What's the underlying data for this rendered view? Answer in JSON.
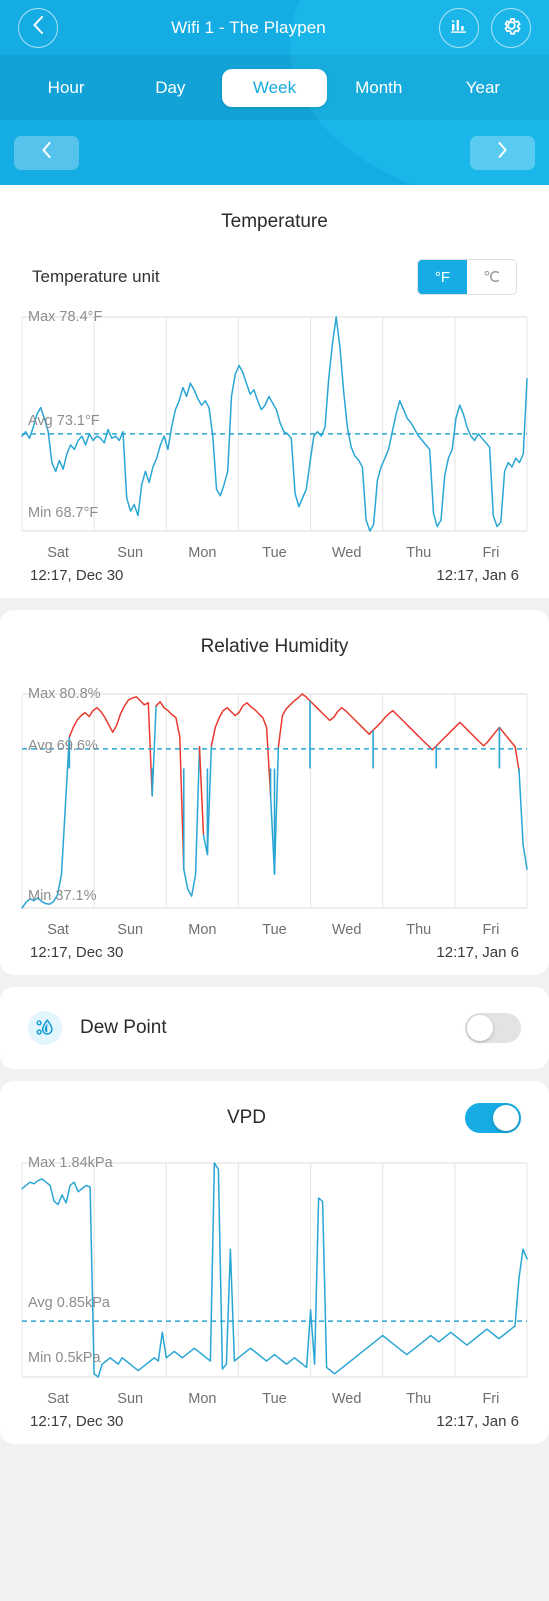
{
  "header": {
    "title": "Wifi 1 - The Playpen",
    "back_icon": "chevron-left-icon",
    "stats_icon": "bar-chart-icon",
    "settings_icon": "gear-icon"
  },
  "tabs": [
    {
      "label": "Hour",
      "active": false
    },
    {
      "label": "Day",
      "active": false
    },
    {
      "label": "Week",
      "active": true
    },
    {
      "label": "Month",
      "active": false
    },
    {
      "label": "Year",
      "active": false
    }
  ],
  "pager": {
    "prev_icon": "chevron-left-icon",
    "next_icon": "chevron-right-icon"
  },
  "temperature": {
    "title": "Temperature",
    "unit_label": "Temperature unit",
    "unit_options": [
      "°F",
      "℃"
    ],
    "unit_selected": "°F",
    "max_label": "Max 78.4°F",
    "avg_label": "Avg 73.1°F",
    "min_label": "Min 68.7°F",
    "range_start": "12:17,  Dec 30",
    "range_end": "12:17,  Jan 6",
    "days": [
      "Sat",
      "Sun",
      "Mon",
      "Tue",
      "Wed",
      "Thu",
      "Fri"
    ]
  },
  "humidity": {
    "title": "Relative Humidity",
    "max_label": "Max 80.8%",
    "avg_label": "Avg 69.6%",
    "min_label": "Min 37.1%",
    "range_start": "12:17,  Dec 30",
    "range_end": "12:17,  Jan 6",
    "days": [
      "Sat",
      "Sun",
      "Mon",
      "Tue",
      "Wed",
      "Thu",
      "Fri"
    ]
  },
  "dew_point": {
    "label": "Dew Point",
    "icon": "humidity-drop-icon",
    "enabled": false
  },
  "vpd": {
    "title": "VPD",
    "enabled": true,
    "max_label": "Max 1.84kPa",
    "avg_label": "Avg 0.85kPa",
    "min_label": "Min 0.5kPa",
    "range_start": "12:17,  Dec 30",
    "range_end": "12:17,  Jan 6",
    "days": [
      "Sat",
      "Sun",
      "Mon",
      "Tue",
      "Wed",
      "Thu",
      "Fri"
    ]
  },
  "colors": {
    "brand": "#17ace4",
    "header": "#14ace3",
    "line_blue": "#2aa6d4",
    "line_red": "#e8392f",
    "grid": "#e8e8e8",
    "avg_dash": "#2aa6d4"
  },
  "chart_data": [
    {
      "type": "line",
      "title": "Temperature",
      "xlabel": "",
      "ylabel": "°F",
      "ylim": [
        68.7,
        78.4
      ],
      "max": 78.4,
      "avg": 73.1,
      "min": 68.7,
      "unit": "°F",
      "categories": [
        "Sat",
        "Sun",
        "Mon",
        "Tue",
        "Wed",
        "Thu",
        "Fri"
      ],
      "x_start": "12:17, Dec 30",
      "x_end": "12:17, Jan 6",
      "grid": true,
      "legend": "none",
      "series": [
        {
          "name": "Temperature",
          "color": "#2aa6d4",
          "values": [
            73.0,
            73.2,
            72.9,
            73.4,
            74.0,
            74.3,
            73.8,
            73.2,
            71.8,
            71.4,
            71.9,
            71.5,
            72.2,
            72.6,
            72.4,
            72.8,
            73.0,
            72.6,
            73.1,
            72.8,
            73.0,
            72.9,
            72.7,
            73.3,
            72.9,
            73.0,
            72.8,
            73.2,
            70.2,
            69.6,
            69.9,
            69.4,
            70.8,
            71.4,
            70.9,
            71.6,
            72.0,
            72.6,
            73.0,
            72.4,
            73.4,
            74.2,
            74.6,
            75.2,
            74.8,
            75.4,
            75.1,
            74.7,
            74.4,
            74.6,
            74.3,
            73.0,
            70.6,
            70.3,
            70.8,
            71.4,
            74.8,
            75.8,
            76.2,
            75.9,
            75.4,
            74.9,
            75.1,
            74.6,
            74.2,
            74.4,
            74.8,
            74.5,
            74.2,
            73.6,
            73.2,
            73.1,
            72.9,
            70.4,
            69.8,
            70.2,
            70.6,
            71.8,
            73.0,
            73.2,
            73.0,
            73.4,
            75.6,
            77.2,
            78.4,
            77.0,
            75.0,
            73.4,
            72.5,
            72.1,
            71.9,
            71.6,
            69.2,
            68.7,
            69.0,
            71.0,
            71.6,
            72.0,
            72.4,
            73.2,
            74.0,
            74.6,
            74.2,
            73.8,
            73.6,
            73.3,
            73.0,
            72.8,
            72.6,
            72.4,
            69.5,
            68.9,
            69.2,
            71.2,
            72.0,
            72.4,
            73.8,
            74.4,
            74.0,
            73.4,
            73.0,
            72.8,
            73.1,
            72.9,
            72.7,
            72.5,
            69.4,
            68.9,
            69.1,
            71.4,
            71.8,
            71.6,
            72.0,
            71.8,
            72.2,
            75.6
          ]
        }
      ]
    },
    {
      "type": "line",
      "title": "Relative Humidity",
      "xlabel": "",
      "ylabel": "%",
      "ylim": [
        37.1,
        80.8
      ],
      "max": 80.8,
      "avg": 69.6,
      "min": 37.1,
      "unit": "%",
      "categories": [
        "Sat",
        "Sun",
        "Mon",
        "Tue",
        "Wed",
        "Thu",
        "Fri"
      ],
      "x_start": "12:17, Dec 30",
      "x_end": "12:17, Jan 6",
      "grid": true,
      "legend": "none",
      "note": "red segments above threshold, blue segments below",
      "series": [
        {
          "name": "Relative Humidity",
          "color": "#e8392f",
          "values": [
            37.1,
            38.2,
            39.0,
            38.6,
            39.2,
            38.4,
            38.0,
            37.9,
            38.4,
            39.8,
            44.0,
            58.0,
            72.0,
            74.0,
            75.5,
            76.4,
            77.0,
            76.2,
            77.4,
            78.0,
            77.2,
            76.0,
            74.5,
            73.0,
            74.4,
            76.8,
            78.4,
            79.6,
            80.0,
            80.2,
            79.4,
            78.6,
            79.0,
            60.0,
            78.4,
            79.2,
            78.0,
            77.4,
            76.6,
            76.0,
            72.0,
            45.0,
            41.0,
            39.5,
            44.0,
            70.0,
            52.0,
            48.0,
            70.2,
            74.0,
            76.0,
            77.4,
            78.0,
            77.2,
            76.4,
            77.0,
            78.4,
            79.0,
            78.2,
            77.6,
            76.8,
            76.0,
            74.0,
            60.0,
            44.0,
            70.0,
            76.4,
            77.8,
            78.6,
            79.4,
            80.0,
            80.8,
            80.2,
            79.4,
            78.6,
            77.8,
            77.0,
            76.2,
            75.4,
            76.0,
            77.2,
            78.0,
            77.4,
            76.6,
            75.8,
            75.0,
            74.2,
            73.4,
            72.6,
            73.4,
            74.2,
            75.0,
            76.0,
            76.8,
            77.4,
            76.6,
            75.8,
            75.0,
            74.2,
            73.4,
            72.6,
            71.8,
            71.0,
            70.2,
            69.4,
            70.2,
            71.0,
            71.8,
            72.6,
            73.4,
            74.2,
            75.0,
            74.2,
            73.4,
            72.6,
            71.8,
            71.0,
            70.2,
            71.0,
            72.0,
            73.0,
            74.0,
            73.0,
            72.0,
            71.0,
            70.0,
            65.0,
            50.0,
            45.0
          ]
        }
      ]
    },
    {
      "type": "line",
      "title": "VPD",
      "xlabel": "",
      "ylabel": "kPa",
      "ylim": [
        0.5,
        1.84
      ],
      "max": 1.84,
      "avg": 0.85,
      "min": 0.5,
      "unit": "kPa",
      "categories": [
        "Sat",
        "Sun",
        "Mon",
        "Tue",
        "Wed",
        "Thu",
        "Fri"
      ],
      "x_start": "12:17, Dec 30",
      "x_end": "12:17, Jan 6",
      "grid": true,
      "legend": "none",
      "series": [
        {
          "name": "VPD",
          "color": "#2aa6d4",
          "values": [
            1.68,
            1.7,
            1.72,
            1.71,
            1.73,
            1.74,
            1.72,
            1.7,
            1.6,
            1.58,
            1.64,
            1.59,
            1.7,
            1.72,
            1.66,
            1.68,
            1.7,
            1.69,
            0.52,
            0.5,
            0.58,
            0.6,
            0.62,
            0.6,
            0.58,
            0.62,
            0.6,
            0.58,
            0.56,
            0.54,
            0.56,
            0.58,
            0.6,
            0.62,
            0.6,
            0.78,
            0.62,
            0.64,
            0.66,
            0.64,
            0.62,
            0.64,
            0.66,
            0.68,
            0.66,
            0.64,
            0.62,
            0.6,
            1.84,
            1.8,
            0.55,
            0.58,
            1.3,
            0.6,
            0.62,
            0.64,
            0.66,
            0.68,
            0.66,
            0.64,
            0.62,
            0.6,
            0.62,
            0.64,
            0.62,
            0.6,
            0.58,
            0.6,
            0.62,
            0.6,
            0.58,
            0.56,
            0.92,
            0.58,
            1.62,
            1.6,
            0.56,
            0.54,
            0.52,
            0.54,
            0.56,
            0.58,
            0.6,
            0.62,
            0.64,
            0.66,
            0.68,
            0.7,
            0.72,
            0.74,
            0.76,
            0.74,
            0.72,
            0.7,
            0.68,
            0.66,
            0.64,
            0.66,
            0.68,
            0.7,
            0.72,
            0.74,
            0.76,
            0.74,
            0.72,
            0.74,
            0.76,
            0.78,
            0.76,
            0.74,
            0.72,
            0.7,
            0.72,
            0.74,
            0.76,
            0.78,
            0.8,
            0.78,
            0.76,
            0.74,
            0.76,
            0.78,
            0.8,
            0.82,
            1.12,
            1.3,
            1.24
          ]
        }
      ]
    }
  ]
}
